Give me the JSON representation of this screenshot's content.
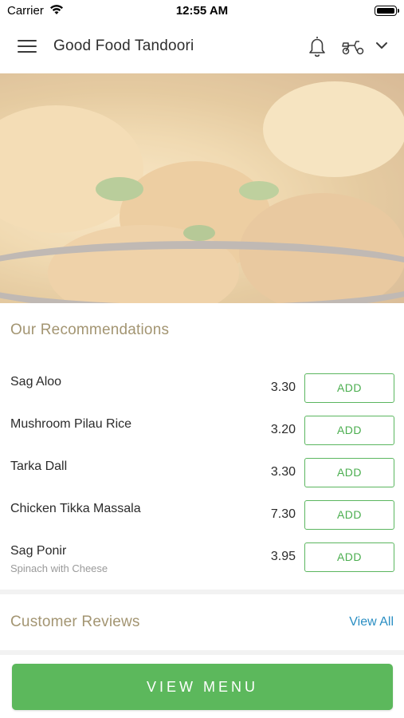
{
  "status_bar": {
    "carrier": "Carrier",
    "time": "12:55 AM"
  },
  "header": {
    "title": "Good Food Tandoori",
    "icons": [
      "menu-icon",
      "bell-icon",
      "scooter-icon",
      "chevron-down-icon"
    ]
  },
  "recommendations": {
    "title": "Our Recommendations",
    "items": [
      {
        "name": "Sag Aloo",
        "description": "",
        "price": "3.30",
        "button": "ADD"
      },
      {
        "name": "Mushroom Pilau Rice",
        "description": "",
        "price": "3.20",
        "button": "ADD"
      },
      {
        "name": "Tarka Dall",
        "description": "",
        "price": "3.30",
        "button": "ADD"
      },
      {
        "name": "Chicken Tikka Massala",
        "description": "",
        "price": "7.30",
        "button": "ADD"
      },
      {
        "name": "Sag Ponir",
        "description": "Spinach with Cheese",
        "price": "3.95",
        "button": "ADD"
      }
    ]
  },
  "reviews": {
    "title": "Customer Reviews",
    "view_all": "View All"
  },
  "cta": {
    "label": "VIEW MENU"
  },
  "colors": {
    "accent_green": "#5cb85c",
    "section_title": "#a39572",
    "link_blue": "#2a8ec3"
  }
}
